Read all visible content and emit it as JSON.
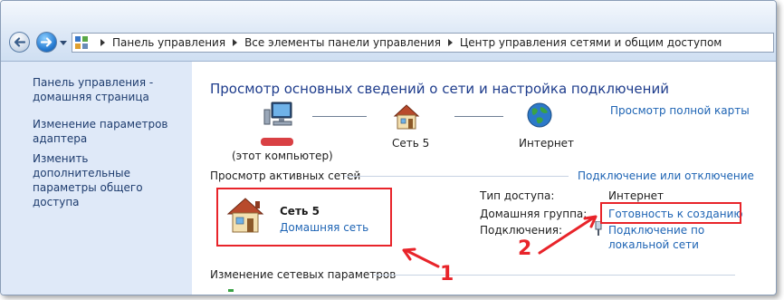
{
  "breadcrumb": {
    "items": [
      "Панель управления",
      "Все элементы панели управления",
      "Центр управления сетями и общим доступом"
    ]
  },
  "sidebar": {
    "items": [
      {
        "label": "Панель управления - домашняя страница"
      },
      {
        "label": "Изменение параметров адаптера"
      },
      {
        "label": "Изменить дополнительные параметры общего доступа"
      }
    ]
  },
  "main": {
    "title": "Просмотр основных сведений о сети и настройка подключений",
    "full_map_link": "Просмотр полной карты",
    "map": {
      "computer_label": "(этот компьютер)",
      "network_label": "Сеть  5",
      "internet_label": "Интернет"
    },
    "active_networks": {
      "heading": "Просмотр активных сетей",
      "connect_link": "Подключение или отключение",
      "network_name": "Сеть  5",
      "network_type": "Домашняя сеть",
      "access_type_label": "Тип доступа:",
      "access_type_value": "Интернет",
      "homegroup_label": "Домашняя группа:",
      "homegroup_value": "Готовность к созданию",
      "connections_label": "Подключения:",
      "connections_value_line1": "Подключение по",
      "connections_value_line2": "локальной сети"
    },
    "change_settings_heading": "Изменение сетевых параметров"
  },
  "callouts": {
    "one": "1",
    "two": "2"
  },
  "colors": {
    "accent_red": "#e8242a",
    "link_blue": "#1e64b4",
    "title_blue": "#1e3c8c",
    "sidebar_bg": "#dfe9f8"
  },
  "icons": [
    "back-arrow-icon",
    "forward-arrow-icon",
    "control-panel-icon",
    "computer-icon",
    "house-icon",
    "globe-icon",
    "network-adapter-icon"
  ]
}
